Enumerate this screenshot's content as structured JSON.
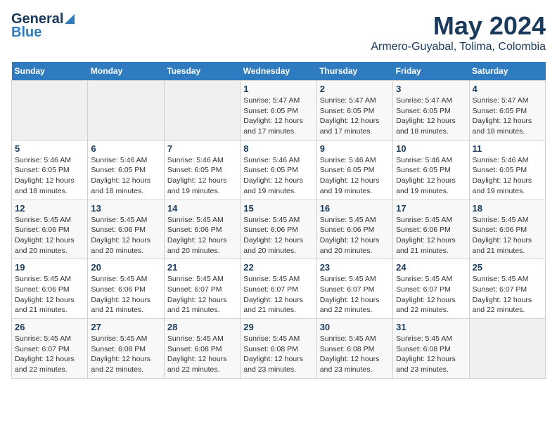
{
  "header": {
    "logo_general": "General",
    "logo_blue": "Blue",
    "title": "May 2024",
    "subtitle": "Armero-Guyabal, Tolima, Colombia"
  },
  "calendar": {
    "days_of_week": [
      "Sunday",
      "Monday",
      "Tuesday",
      "Wednesday",
      "Thursday",
      "Friday",
      "Saturday"
    ],
    "weeks": [
      [
        {
          "day": "",
          "info": ""
        },
        {
          "day": "",
          "info": ""
        },
        {
          "day": "",
          "info": ""
        },
        {
          "day": "1",
          "info": "Sunrise: 5:47 AM\nSunset: 6:05 PM\nDaylight: 12 hours\nand 17 minutes."
        },
        {
          "day": "2",
          "info": "Sunrise: 5:47 AM\nSunset: 6:05 PM\nDaylight: 12 hours\nand 17 minutes."
        },
        {
          "day": "3",
          "info": "Sunrise: 5:47 AM\nSunset: 6:05 PM\nDaylight: 12 hours\nand 18 minutes."
        },
        {
          "day": "4",
          "info": "Sunrise: 5:47 AM\nSunset: 6:05 PM\nDaylight: 12 hours\nand 18 minutes."
        }
      ],
      [
        {
          "day": "5",
          "info": "Sunrise: 5:46 AM\nSunset: 6:05 PM\nDaylight: 12 hours\nand 18 minutes."
        },
        {
          "day": "6",
          "info": "Sunrise: 5:46 AM\nSunset: 6:05 PM\nDaylight: 12 hours\nand 18 minutes."
        },
        {
          "day": "7",
          "info": "Sunrise: 5:46 AM\nSunset: 6:05 PM\nDaylight: 12 hours\nand 19 minutes."
        },
        {
          "day": "8",
          "info": "Sunrise: 5:46 AM\nSunset: 6:05 PM\nDaylight: 12 hours\nand 19 minutes."
        },
        {
          "day": "9",
          "info": "Sunrise: 5:46 AM\nSunset: 6:05 PM\nDaylight: 12 hours\nand 19 minutes."
        },
        {
          "day": "10",
          "info": "Sunrise: 5:46 AM\nSunset: 6:05 PM\nDaylight: 12 hours\nand 19 minutes."
        },
        {
          "day": "11",
          "info": "Sunrise: 5:46 AM\nSunset: 6:05 PM\nDaylight: 12 hours\nand 19 minutes."
        }
      ],
      [
        {
          "day": "12",
          "info": "Sunrise: 5:45 AM\nSunset: 6:06 PM\nDaylight: 12 hours\nand 20 minutes."
        },
        {
          "day": "13",
          "info": "Sunrise: 5:45 AM\nSunset: 6:06 PM\nDaylight: 12 hours\nand 20 minutes."
        },
        {
          "day": "14",
          "info": "Sunrise: 5:45 AM\nSunset: 6:06 PM\nDaylight: 12 hours\nand 20 minutes."
        },
        {
          "day": "15",
          "info": "Sunrise: 5:45 AM\nSunset: 6:06 PM\nDaylight: 12 hours\nand 20 minutes."
        },
        {
          "day": "16",
          "info": "Sunrise: 5:45 AM\nSunset: 6:06 PM\nDaylight: 12 hours\nand 20 minutes."
        },
        {
          "day": "17",
          "info": "Sunrise: 5:45 AM\nSunset: 6:06 PM\nDaylight: 12 hours\nand 21 minutes."
        },
        {
          "day": "18",
          "info": "Sunrise: 5:45 AM\nSunset: 6:06 PM\nDaylight: 12 hours\nand 21 minutes."
        }
      ],
      [
        {
          "day": "19",
          "info": "Sunrise: 5:45 AM\nSunset: 6:06 PM\nDaylight: 12 hours\nand 21 minutes."
        },
        {
          "day": "20",
          "info": "Sunrise: 5:45 AM\nSunset: 6:06 PM\nDaylight: 12 hours\nand 21 minutes."
        },
        {
          "day": "21",
          "info": "Sunrise: 5:45 AM\nSunset: 6:07 PM\nDaylight: 12 hours\nand 21 minutes."
        },
        {
          "day": "22",
          "info": "Sunrise: 5:45 AM\nSunset: 6:07 PM\nDaylight: 12 hours\nand 21 minutes."
        },
        {
          "day": "23",
          "info": "Sunrise: 5:45 AM\nSunset: 6:07 PM\nDaylight: 12 hours\nand 22 minutes."
        },
        {
          "day": "24",
          "info": "Sunrise: 5:45 AM\nSunset: 6:07 PM\nDaylight: 12 hours\nand 22 minutes."
        },
        {
          "day": "25",
          "info": "Sunrise: 5:45 AM\nSunset: 6:07 PM\nDaylight: 12 hours\nand 22 minutes."
        }
      ],
      [
        {
          "day": "26",
          "info": "Sunrise: 5:45 AM\nSunset: 6:07 PM\nDaylight: 12 hours\nand 22 minutes."
        },
        {
          "day": "27",
          "info": "Sunrise: 5:45 AM\nSunset: 6:08 PM\nDaylight: 12 hours\nand 22 minutes."
        },
        {
          "day": "28",
          "info": "Sunrise: 5:45 AM\nSunset: 6:08 PM\nDaylight: 12 hours\nand 22 minutes."
        },
        {
          "day": "29",
          "info": "Sunrise: 5:45 AM\nSunset: 6:08 PM\nDaylight: 12 hours\nand 23 minutes."
        },
        {
          "day": "30",
          "info": "Sunrise: 5:45 AM\nSunset: 6:08 PM\nDaylight: 12 hours\nand 23 minutes."
        },
        {
          "day": "31",
          "info": "Sunrise: 5:45 AM\nSunset: 6:08 PM\nDaylight: 12 hours\nand 23 minutes."
        },
        {
          "day": "",
          "info": ""
        }
      ]
    ]
  }
}
